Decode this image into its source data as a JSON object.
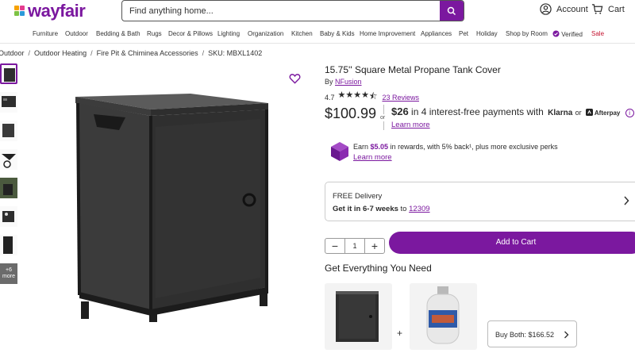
{
  "header": {
    "logo_text": "wayfair",
    "search_placeholder": "Find anything home...",
    "account_label": "Account",
    "cart_label": "Cart"
  },
  "nav": {
    "items": [
      "Furniture",
      "Outdoor",
      "Bedding & Bath",
      "Rugs",
      "Decor & Pillows",
      "Lighting",
      "Organization",
      "Kitchen",
      "Baby & Kids",
      "Home Improvement",
      "Appliances",
      "Pet",
      "Holiday",
      "Shop by Room",
      "Verified",
      "Sale"
    ]
  },
  "breadcrumb": {
    "items": [
      "Outdoor",
      "Outdoor Heating",
      "Fire Pit & Chiminea Accessories",
      "SKU: MBXL1402"
    ]
  },
  "gallery": {
    "more_label_1": "+6",
    "more_label_2": "more"
  },
  "product": {
    "title": "15.75'' Square Metal Propane Tank Cover",
    "by_prefix": "By",
    "brand": "NFusion",
    "rating": "4.7",
    "reviews": "23 Reviews",
    "price": "$100.99",
    "or": "or",
    "installment_amount": "$26",
    "installment_text": "in 4 interest-free payments with",
    "klarna": "Klarna",
    "or_small": "or",
    "afterpay": "Afterpay",
    "learn_more": "Learn more"
  },
  "rewards": {
    "prefix": "Earn",
    "amount": "$5.05",
    "suffix": "in rewards, with 5% back¹, plus more exclusive perks",
    "learn_more": "Learn more"
  },
  "delivery": {
    "line1": "FREE Delivery",
    "line2_bold": "Get it in 6-7 weeks",
    "line2_to": "to",
    "zip": "12309"
  },
  "purchase": {
    "quantity": "1",
    "add_to_cart": "Add to Cart"
  },
  "bundle": {
    "heading": "Get Everything You Need",
    "plus": "+",
    "buy_both": "Buy Both: $166.52"
  },
  "colors": {
    "brand": "#7b189f",
    "sale": "#c4122f"
  }
}
